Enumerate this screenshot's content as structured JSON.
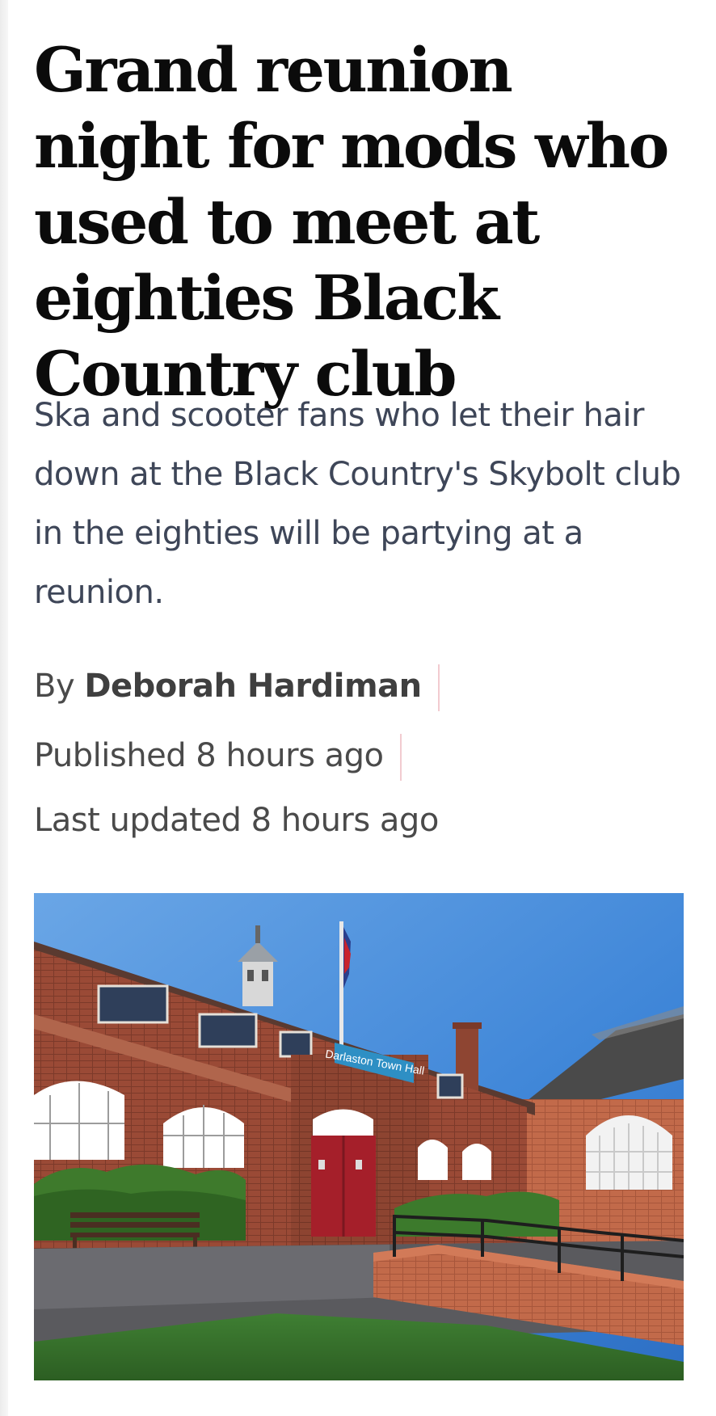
{
  "article": {
    "headline": "Grand reunion night for mods who used to meet at eighties Black Country club",
    "standfirst": "Ska and scooter fans who let their hair down at the Black Country's Skybolt club in the eighties will be partying at a reunion.",
    "byline": {
      "prefix": "By",
      "author": "Deborah Hardiman"
    },
    "published": "Published 8 hours ago",
    "updated": "Last updated 8 hours ago",
    "image": {
      "sign_text": "Darlaston Town Hall"
    }
  },
  "colors": {
    "headline": "#0b0b0b",
    "standfirst": "#3e4658",
    "meta": "#4a4a4a",
    "separator": "#f2cbd0"
  }
}
